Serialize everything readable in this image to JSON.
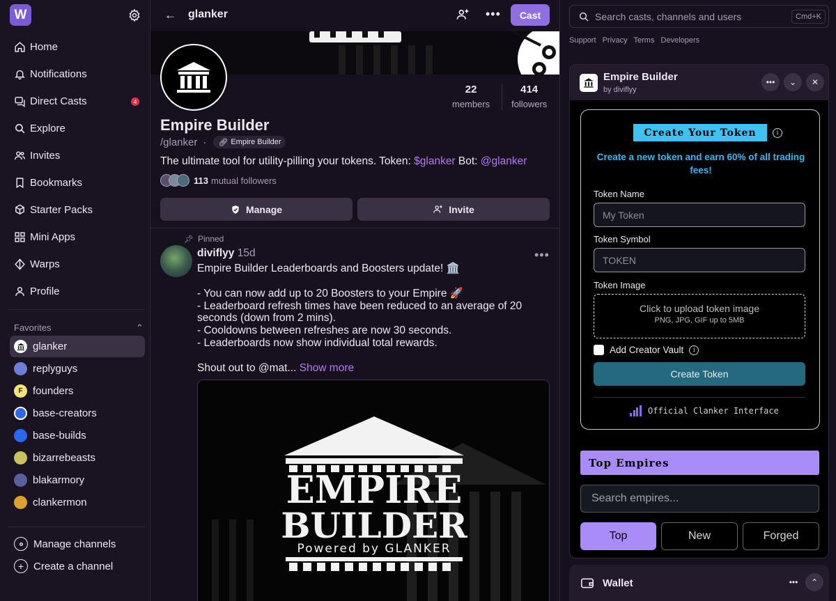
{
  "sidebar": {
    "logo_letter": "W",
    "nav": [
      {
        "label": "Home",
        "icon": "home-icon"
      },
      {
        "label": "Notifications",
        "icon": "bell-icon"
      },
      {
        "label": "Direct Casts",
        "icon": "chat-icon",
        "badge": "4"
      },
      {
        "label": "Explore",
        "icon": "search-icon"
      },
      {
        "label": "Invites",
        "icon": "users-icon"
      },
      {
        "label": "Bookmarks",
        "icon": "bookmark-icon"
      },
      {
        "label": "Starter Packs",
        "icon": "starter-pack-icon"
      },
      {
        "label": "Mini Apps",
        "icon": "grid-icon"
      },
      {
        "label": "Warps",
        "icon": "diamond-icon"
      },
      {
        "label": "Profile",
        "icon": "person-icon"
      }
    ],
    "favorites_title": "Favorites",
    "favorites": [
      {
        "label": "glanker",
        "color": "#ffffff",
        "initial": ""
      },
      {
        "label": "replyguys",
        "color": "#6c7fd4",
        "initial": ""
      },
      {
        "label": "founders",
        "color": "#f4e27a",
        "initial": "F"
      },
      {
        "label": "base-creators",
        "color": "#2d67f0",
        "initial": ""
      },
      {
        "label": "base-builds",
        "color": "#2d67f0",
        "initial": ""
      },
      {
        "label": "bizarrebeasts",
        "color": "#c9c060",
        "initial": ""
      },
      {
        "label": "blakarmory",
        "color": "#5a5f9a",
        "initial": ""
      },
      {
        "label": "clankermon",
        "color": "#e0a030",
        "initial": ""
      }
    ],
    "manage_channels": "Manage channels",
    "create_channel": "Create a channel"
  },
  "main": {
    "channel_title": "glanker",
    "cast_label": "Cast",
    "channel": {
      "name": "Empire Builder",
      "handle": "/glanker",
      "separator": "·",
      "chip": "Empire Builder",
      "desc_prefix": "The ultimate tool for utility-pilling your tokens. Token: ",
      "token_link": "$glanker",
      "desc_mid": " Bot: ",
      "bot_link": "@glanker",
      "members_count": "22",
      "members_label": "members",
      "followers_count": "414",
      "followers_label": "followers",
      "mutual_count": "113",
      "mutual_label": "mutual followers",
      "manage_label": "Manage",
      "invite_label": "Invite"
    },
    "post": {
      "pinned_label": "Pinned",
      "author": "diviflyy",
      "age": "15d",
      "line1": "Empire Builder Leaderboards and Boosters update! 🏛️",
      "body": "- You can now add up to 20 Boosters to your Empire 🚀\n- Leaderboard refresh times have been reduced to an average of 20 seconds (down from 2 mins).\n- Cooldowns between refreshes are now 30 seconds.\n- Leaderboards now show individual total rewards.",
      "shoutout": "Shout out to @mat... ",
      "show_more": "Show more",
      "image_line1": "EMPIRE",
      "image_line2": "BUILDER",
      "image_line3": "Powered by GLANKER"
    }
  },
  "right": {
    "search_placeholder": "Search casts, channels and users",
    "search_shortcut": "Cmd+K",
    "links": [
      "Support",
      "Privacy",
      "Terms",
      "Developers"
    ],
    "miniapp": {
      "title": "Empire Builder",
      "subtitle": "by diviflyy",
      "create_title": "Create Your Token",
      "create_sub": "Create a new token and earn 60% of all trading fees!",
      "token_name_label": "Token Name",
      "token_name_placeholder": "My Token",
      "token_symbol_label": "Token Symbol",
      "token_symbol_placeholder": "TOKEN",
      "token_image_label": "Token Image",
      "upload_text": "Click to upload token image",
      "upload_hint": "PNG, JPG, GIF up to 5MB",
      "creator_vault_label": "Add Creator Vault",
      "create_btn": "Create Token",
      "official": "Official Clanker Interface",
      "top_empires": "Top Empires",
      "search_empires": "Search empires...",
      "tabs": [
        "Top",
        "New",
        "Forged"
      ]
    },
    "wallet_label": "Wallet"
  },
  "colors": {
    "accent": "#8f6fe0",
    "token_link": "#b27af2",
    "create_pill": "#3fc1f2",
    "create_btn": "#25697e",
    "top_empires": "#a98cf8"
  }
}
